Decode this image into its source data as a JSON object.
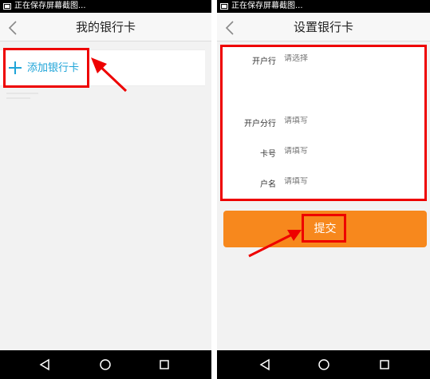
{
  "left_screen": {
    "status_text": "正在保存屏幕截图...",
    "title": "我的银行卡",
    "add_card_label": "添加银行卡"
  },
  "right_screen": {
    "status_text": "正在保存屏幕截图...",
    "title": "设置银行卡",
    "form": {
      "fields": [
        {
          "label": "开户行",
          "placeholder": "请选择"
        },
        {
          "label": "开户分行",
          "placeholder": "请填写"
        },
        {
          "label": "卡号",
          "placeholder": "请填写"
        },
        {
          "label": "户名",
          "placeholder": "请填写"
        }
      ]
    },
    "submit_label": "提交"
  },
  "colors": {
    "accent_blue": "#1ea4d8",
    "submit_orange": "#f7881d",
    "annotation_red": "#e00000"
  },
  "icons": [
    "back-chevron-icon",
    "plus-icon",
    "nav-back-icon",
    "nav-home-icon",
    "nav-recents-icon",
    "annotation-arrow-icon"
  ]
}
